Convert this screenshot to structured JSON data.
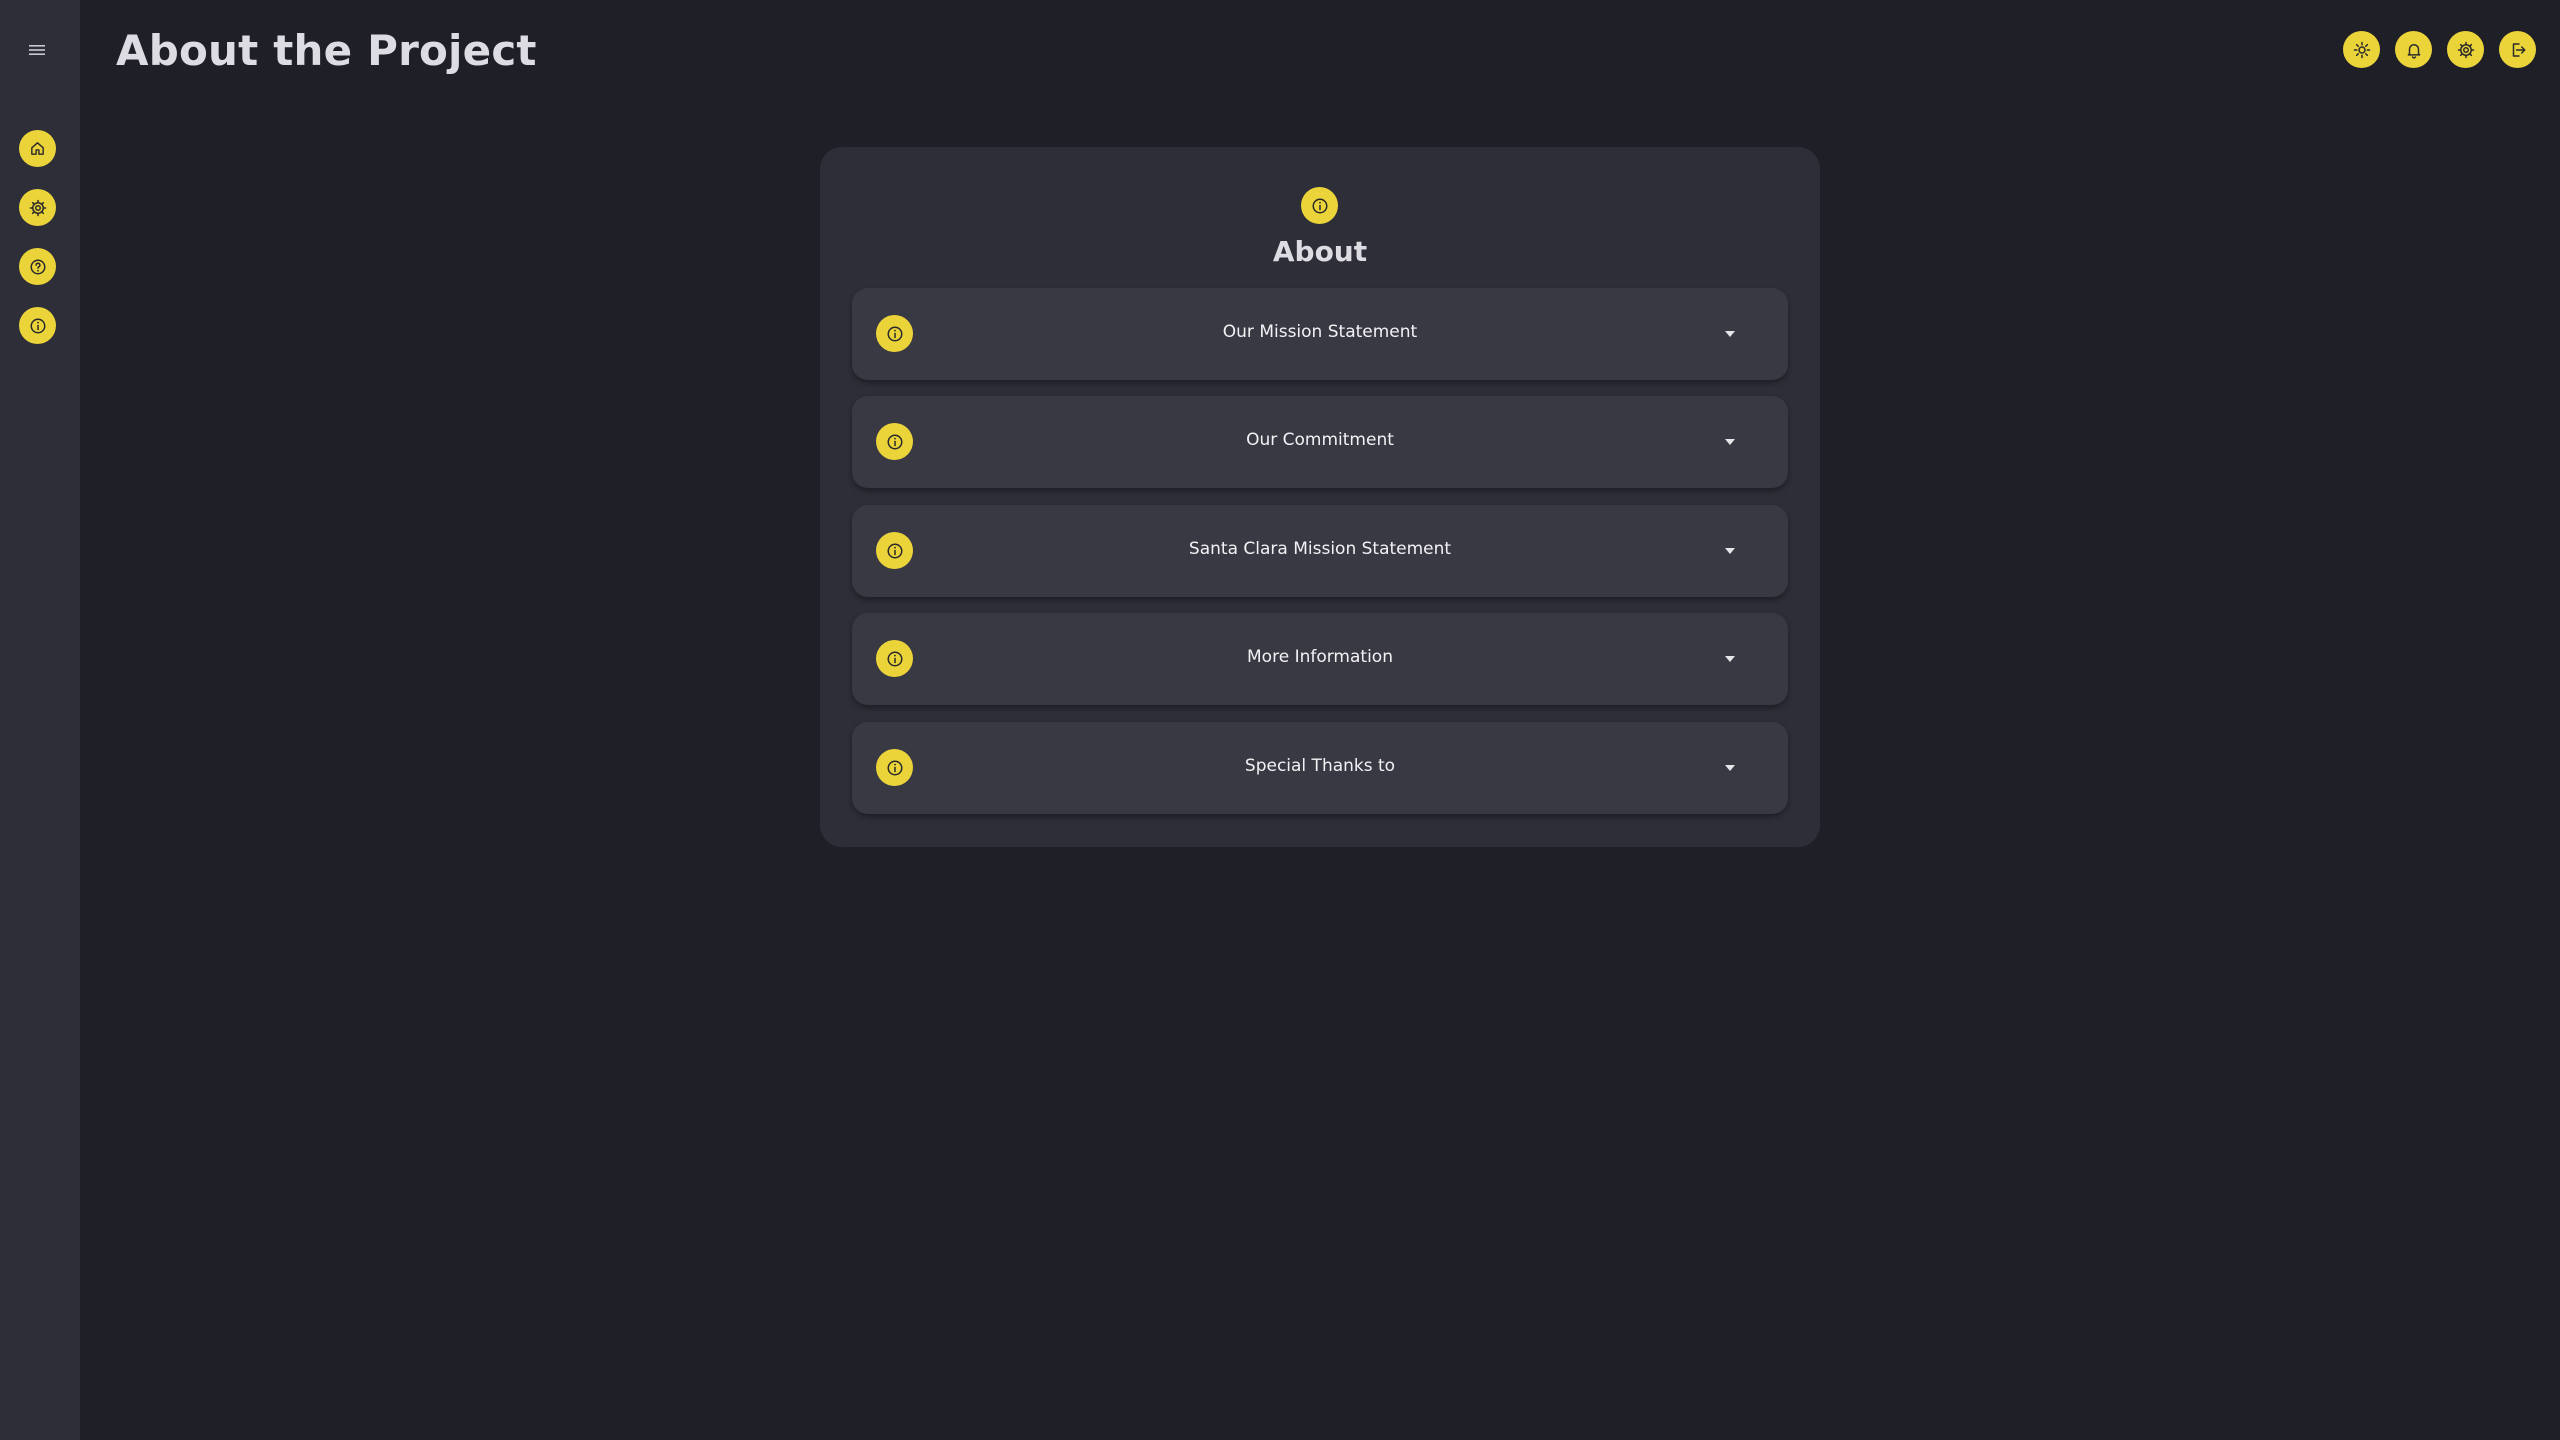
{
  "header": {
    "title": "About the Project"
  },
  "sidebar": {
    "menu_icon": "hamburger-icon",
    "items": [
      {
        "icon": "home-icon"
      },
      {
        "icon": "gear-icon"
      },
      {
        "icon": "help-icon"
      },
      {
        "icon": "info-icon"
      }
    ]
  },
  "topbar": {
    "icons": [
      "sun-icon",
      "bell-icon",
      "gear-icon",
      "logout-icon"
    ]
  },
  "about_card": {
    "title": "About",
    "sections": [
      {
        "label": "Our Mission Statement"
      },
      {
        "label": "Our Commitment"
      },
      {
        "label": "Santa Clara Mission Statement"
      },
      {
        "label": "More Information"
      },
      {
        "label": "Special Thanks to"
      }
    ]
  },
  "colors": {
    "background": "#1f1f27",
    "panel": "#2e2e38",
    "accordion": "#393943",
    "accent": "#ebd43a",
    "text": "#dcdce2"
  }
}
